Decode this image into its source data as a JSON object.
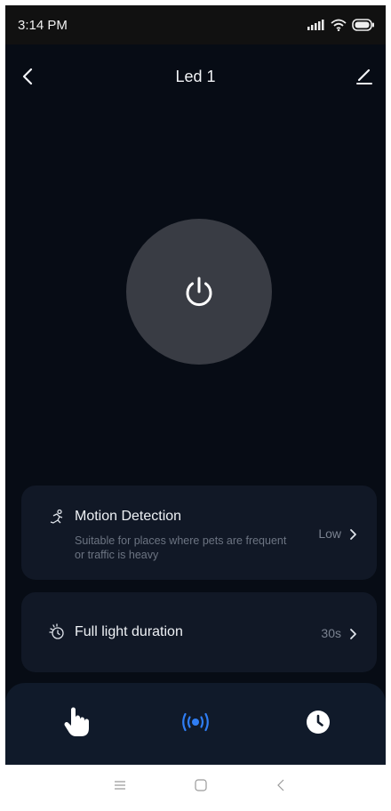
{
  "status_bar": {
    "time": "3:14 PM",
    "icons": [
      "signal-icon",
      "wifi-icon",
      "battery-icon"
    ]
  },
  "header": {
    "title": "Led 1",
    "back_icon": "chevron-left-icon",
    "edit_icon": "pencil-icon"
  },
  "power_button": {
    "icon": "power-icon",
    "state": "off"
  },
  "settings": {
    "motion_detection": {
      "icon": "running-person-icon",
      "title": "Motion Detection",
      "description": "Suitable for places where pets are frequent or traffic is heavy",
      "value": "Low"
    },
    "full_light_duration": {
      "icon": "light-timer-icon",
      "title": "Full light duration",
      "value": "30s"
    }
  },
  "tabs": [
    {
      "icon": "hand-pointer-icon",
      "active": false
    },
    {
      "icon": "sensor-waves-icon",
      "active": true
    },
    {
      "icon": "clock-icon",
      "active": false
    }
  ],
  "colors": {
    "background": "#070c15",
    "card": "#111826",
    "power_circle": "#393c44",
    "accent": "#2f7ef5",
    "muted_text": "#6c7482"
  },
  "system_nav": [
    "menu-icon",
    "home-icon",
    "back-icon"
  ]
}
